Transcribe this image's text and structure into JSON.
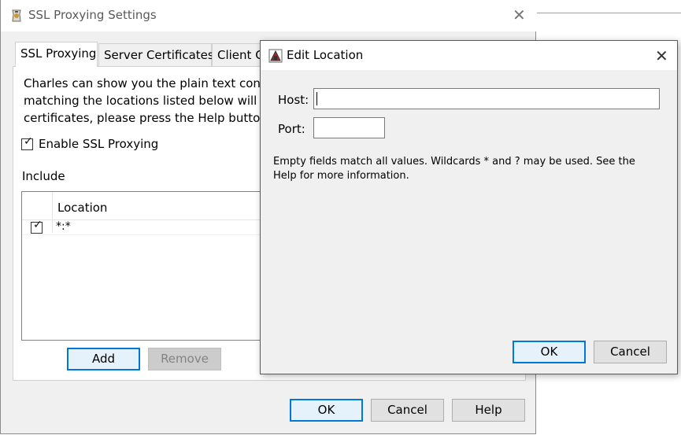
{
  "main_window": {
    "title": "SSL Proxying Settings",
    "tabs": [
      {
        "label": "SSL Proxying",
        "active": true
      },
      {
        "label": "Server Certificates",
        "active": false
      },
      {
        "label": "Client C",
        "active": false
      }
    ],
    "description_lines": [
      "Charles can show you the plain text conten",
      "matching the locations listed below will b",
      "certificates, please press the Help button f"
    ],
    "enable_ssl_label": "Enable SSL Proxying",
    "enable_ssl_checked": true,
    "include_label": "Include",
    "list": {
      "column_header": "Location",
      "rows": [
        {
          "checked": true,
          "location": "*:*"
        }
      ]
    },
    "add_label": "Add",
    "remove_label": "Remove",
    "ok_label": "OK",
    "cancel_label": "Cancel",
    "help_label": "Help"
  },
  "dialog": {
    "title": "Edit Location",
    "host_label": "Host:",
    "host_value": "",
    "port_label": "Port:",
    "port_value": "",
    "help_text": "Empty fields match all values. Wildcards * and ? may be used. See the Help for more information.",
    "ok_label": "OK",
    "cancel_label": "Cancel"
  },
  "colors": {
    "window_bg": "#f0f0f0",
    "accent": "#0078d7",
    "disabled_button": "#cccccc"
  },
  "icons": [
    "charles-app-icon",
    "close-icon",
    "checkmark-icon",
    "edit-location-icon"
  ]
}
